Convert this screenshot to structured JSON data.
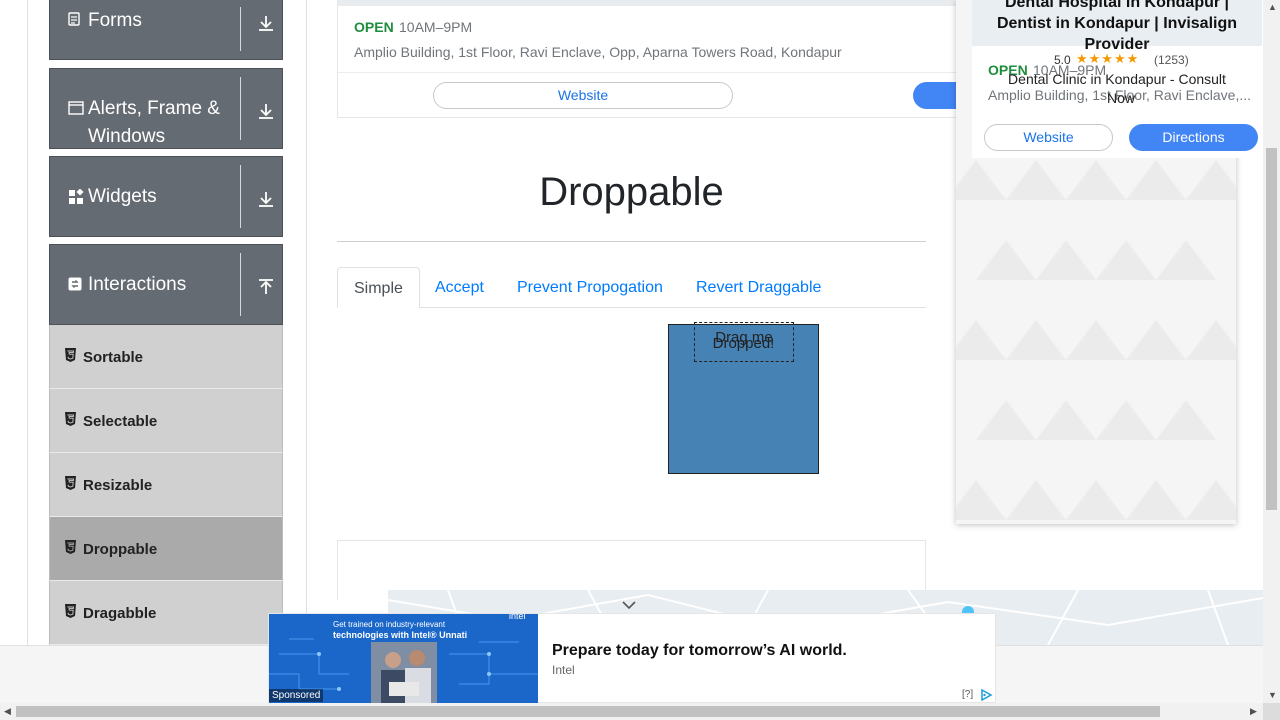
{
  "sidebar": {
    "groups": [
      {
        "label": "Forms",
        "icon": "document-icon",
        "arrow": "download-arrow-icon"
      },
      {
        "label": "Alerts, Frame &",
        "label2": "Windows",
        "icon": "window-icon",
        "arrow": "download-arrow-icon"
      },
      {
        "label": "Widgets",
        "icon": "widgets-icon",
        "arrow": "download-arrow-icon"
      },
      {
        "label": "Interactions",
        "icon": "interactions-icon",
        "arrow": "upload-arrow-icon"
      }
    ],
    "items": [
      {
        "label": "Sortable"
      },
      {
        "label": "Selectable"
      },
      {
        "label": "Resizable"
      },
      {
        "label": "Droppable",
        "active": true
      },
      {
        "label": "Dragabble"
      }
    ]
  },
  "place_card": {
    "open": "OPEN",
    "hours": "10AM–9PM",
    "address": "Amplio Building, 1st Floor, Ravi Enclave, Opp, Aparna Towers Road, Kondapur",
    "website": "Website"
  },
  "main": {
    "title": "Droppable",
    "tabs": [
      "Simple",
      "Accept",
      "Prevent Propogation",
      "Revert Draggable"
    ],
    "active_tab": "Simple",
    "drop_text": "Dropped!",
    "drag_text": "Drag me"
  },
  "map_ad": {
    "title_line1": "Dental Hospital in Kondapur |",
    "title_line2": "Dentist in Kondapur | Invisalign",
    "title_line3": "Provider",
    "rating": "5.0",
    "stars": "★★★★★",
    "review_count": "(1253)",
    "open": "OPEN",
    "hours": "10AM–9PM",
    "subtitle_line1": "Dental Clinic in Kondapur - Consult",
    "subtitle_line2": "Now",
    "address": "Amplio Building, 1st Floor, Ravi Enclave,...",
    "website": "Website",
    "directions": "Directions"
  },
  "banner": {
    "img_line1": "Get trained on industry-relevant",
    "img_line2": "technologies with Intel® Unnati",
    "img_brand": "intel",
    "sponsored": "Sponsored",
    "headline": "Prepare today for tomorrow’s AI world.",
    "advertiser": "Intel",
    "help": "[?]"
  },
  "colors": {
    "sidebar_group": "#656b72",
    "sidebar_item": "#d0d0d0",
    "sidebar_item_active": "#aaaaaa",
    "droppable_fill": "#4682b4",
    "link_blue": "#007bff",
    "open_green": "#1e8e3e",
    "directions_blue": "#4285f4"
  }
}
